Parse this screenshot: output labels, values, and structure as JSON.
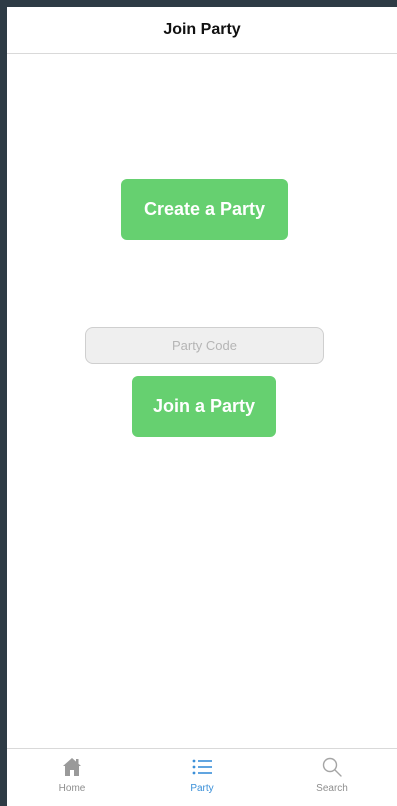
{
  "navbar": {
    "title": "Join Party"
  },
  "main": {
    "create_button_label": "Create a Party",
    "party_code_placeholder": "Party Code",
    "party_code_value": "",
    "join_button_label": "Join a Party"
  },
  "tabbar": {
    "active_tab": "Party",
    "tabs": [
      {
        "label": "Home",
        "icon": "home-icon"
      },
      {
        "label": "Party",
        "icon": "list-icon"
      },
      {
        "label": "Search",
        "icon": "search-icon"
      }
    ]
  },
  "colors": {
    "accent_green": "#66d070",
    "tab_active": "#3a8fd8",
    "tab_inactive": "#8e8e8e"
  }
}
